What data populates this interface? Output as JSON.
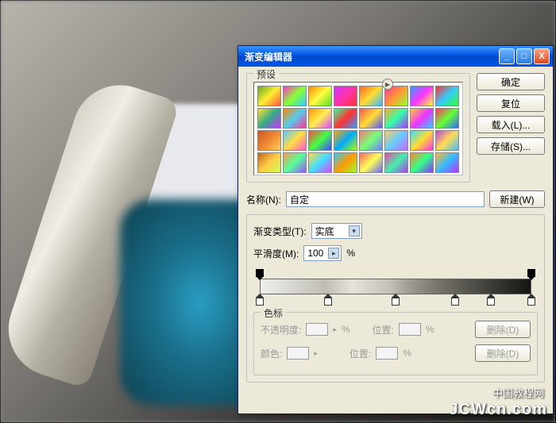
{
  "window": {
    "title": "渐变编辑器"
  },
  "presets": {
    "label": "预设",
    "swatches": [
      "linear-gradient(135deg,#6a2,#fe3,#f53)",
      "linear-gradient(135deg,#f3c,#8f3,#3cf)",
      "linear-gradient(135deg,#f80,#ff4,#5d2)",
      "linear-gradient(135deg,#c3f,#f3a,#f33)",
      "linear-gradient(135deg,#f62,#fd3,#3bf)",
      "linear-gradient(135deg,#f39,#f93,#9f3)",
      "linear-gradient(135deg,#39f,#f3f,#ff3)",
      "linear-gradient(135deg,#f33,#3cf,#3f3)",
      "linear-gradient(135deg,#fd3,#3a8,#c3f)",
      "linear-gradient(135deg,#f80,#5ce,#f39)",
      "linear-gradient(135deg,#f90,#fe5,#d4f)",
      "linear-gradient(135deg,#3f9,#f33,#39f)",
      "linear-gradient(135deg,#f55,#fd3,#55f)",
      "linear-gradient(135deg,#fa3,#3fa,#a3f)",
      "linear-gradient(135deg,#fc3,#e3f,#3cf)",
      "linear-gradient(135deg,#f36,#6f3,#36f)",
      "linear-gradient(135deg,#c52,#e83,#fc5)",
      "linear-gradient(135deg,#5cf,#fd4,#f5c)",
      "linear-gradient(135deg,#f44,#4f4,#44f)",
      "linear-gradient(135deg,#fa0,#0af,#af0)",
      "linear-gradient(135deg,#f77,#7f7,#77f)",
      "linear-gradient(135deg,#fc6,#6cf,#c6f)",
      "linear-gradient(135deg,#3df,#fd3,#f3d)",
      "linear-gradient(135deg,#b4d,#fd5,#4bf)",
      "linear-gradient(135deg,#b62,#fc4,#cf5)",
      "linear-gradient(135deg,#f95,#5f9,#95f)",
      "linear-gradient(135deg,#fd4,#4df,#d4f)",
      "linear-gradient(135deg,#3cf,#f90,#9f3)",
      "linear-gradient(135deg,#f66,#ff5,#66f)",
      "linear-gradient(135deg,#e4a,#4ea,#a4e)",
      "linear-gradient(135deg,#f83,#3f8,#83f)",
      "linear-gradient(135deg,#fb3,#3bf,#b3f)"
    ]
  },
  "buttons": {
    "ok": "确定",
    "reset": "复位",
    "load": "载入(L)...",
    "save": "存储(S)...",
    "new": "新建(W)"
  },
  "name": {
    "label": "名称(N):",
    "value": "自定"
  },
  "gradient_type": {
    "label": "渐变类型(T):",
    "value": "实底"
  },
  "smoothness": {
    "label": "平滑度(M):",
    "value": "100",
    "unit": "%"
  },
  "gradient_bar": {
    "css": "linear-gradient(90deg,#efeeea 0%,#d8d6d0 12%,#bfbdb6 24%,#e5e3dc 34%,#c3c1ba 48%,#9a9890 56%,#7c7a73 64%,#5e5c55 74%,#3b3a35 86%,#151411 100%)",
    "opacity_stops": [
      0,
      100
    ],
    "color_stops": [
      0,
      25,
      50,
      72,
      85,
      100
    ]
  },
  "stops_group": {
    "label": "色标",
    "opacity_label": "不透明度:",
    "opacity_unit": "%",
    "pos_label": "位置:",
    "color_label": "颜色:",
    "delete": "删除(D)"
  },
  "watermark": {
    "cn": "中国教程网",
    "en": "JCWcn.com"
  }
}
